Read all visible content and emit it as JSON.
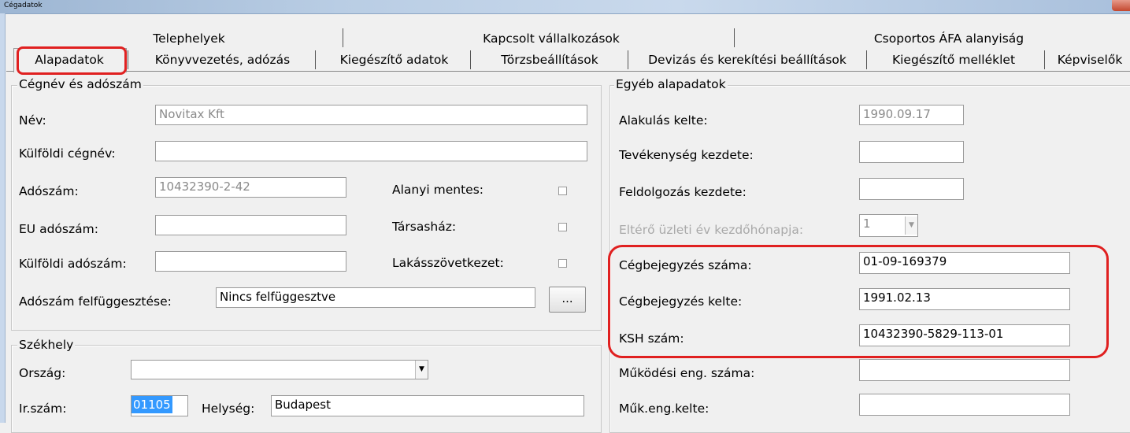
{
  "window": {
    "title": "Cégadatok"
  },
  "tabs": {
    "row1": [
      "Telephelyek",
      "Kapcsolt vállalkozások",
      "Csoportos ÁFA alanyiság"
    ],
    "row2": [
      "Alapadatok",
      "Könyvvezetés, adózás",
      "Kiegészítő adatok",
      "Törzsbeállítások",
      "Devizás és kerekítési beállítások",
      "Kiegészítő melléklet",
      "Képviselők"
    ],
    "selected": "Alapadatok"
  },
  "cegnev_group": {
    "title": "Cégnév és adószám",
    "nev_label": "Név:",
    "nev_value": "Novitax Kft",
    "kulfoldi_cegnev_label": "Külföldi cégnév:",
    "kulfoldi_cegnev_value": "",
    "adoszam_label": "Adószám:",
    "adoszam_value": "10432390-2-42",
    "eu_adoszam_label": "EU adószám:",
    "eu_adoszam_value": "",
    "kulfoldi_adoszam_label": "Külföldi adószám:",
    "kulfoldi_adoszam_value": "",
    "alanyi_mentes_label": "Alanyi mentes:",
    "tarsashaz_label": "Társasház:",
    "lakasszovetkezet_label": "Lakásszövetkezet:",
    "felfuggesztes_label": "Adószám felfüggesztése:",
    "felfuggesztes_value": "Nincs felfüggesztve",
    "browse_label": "..."
  },
  "szekhely_group": {
    "title": "Székhely",
    "orszag_label": "Ország:",
    "orszag_value": "",
    "irszam_label": "Ir.szám:",
    "irszam_value": "01105",
    "helyseg_label": "Helység:",
    "helyseg_value": "Budapest"
  },
  "egyeb_group": {
    "title": "Egyéb alapadatok",
    "alakulas_label": "Alakulás kelte:",
    "alakulas_value": "1990.09.17",
    "tevekenyseg_label": "Tevékenység kezdete:",
    "tevekenyseg_value": "",
    "feldolgozas_label": "Feldolgozás kezdete:",
    "feldolgozas_value": "",
    "elter_label": "Eltérő üzleti év kezdőhónapja:",
    "elter_value": "1",
    "cegbejegyzes_szama_label": "Cégbejegyzés száma:",
    "cegbejegyzes_szama_value": "01-09-169379",
    "cegbejegyzes_kelte_label": "Cégbejegyzés kelte:",
    "cegbejegyzes_kelte_value": "1991.02.13",
    "ksh_label": "KSH szám:",
    "ksh_value": "10432390-5829-113-01",
    "mukodesi_label": "Működési eng. száma:",
    "mukodesi_value": "",
    "mukeng_kelte_label": "Műk.eng.kelte:",
    "mukeng_kelte_value": ""
  },
  "colors": {
    "highlight": "#e02020",
    "selection": "#3399ff"
  }
}
